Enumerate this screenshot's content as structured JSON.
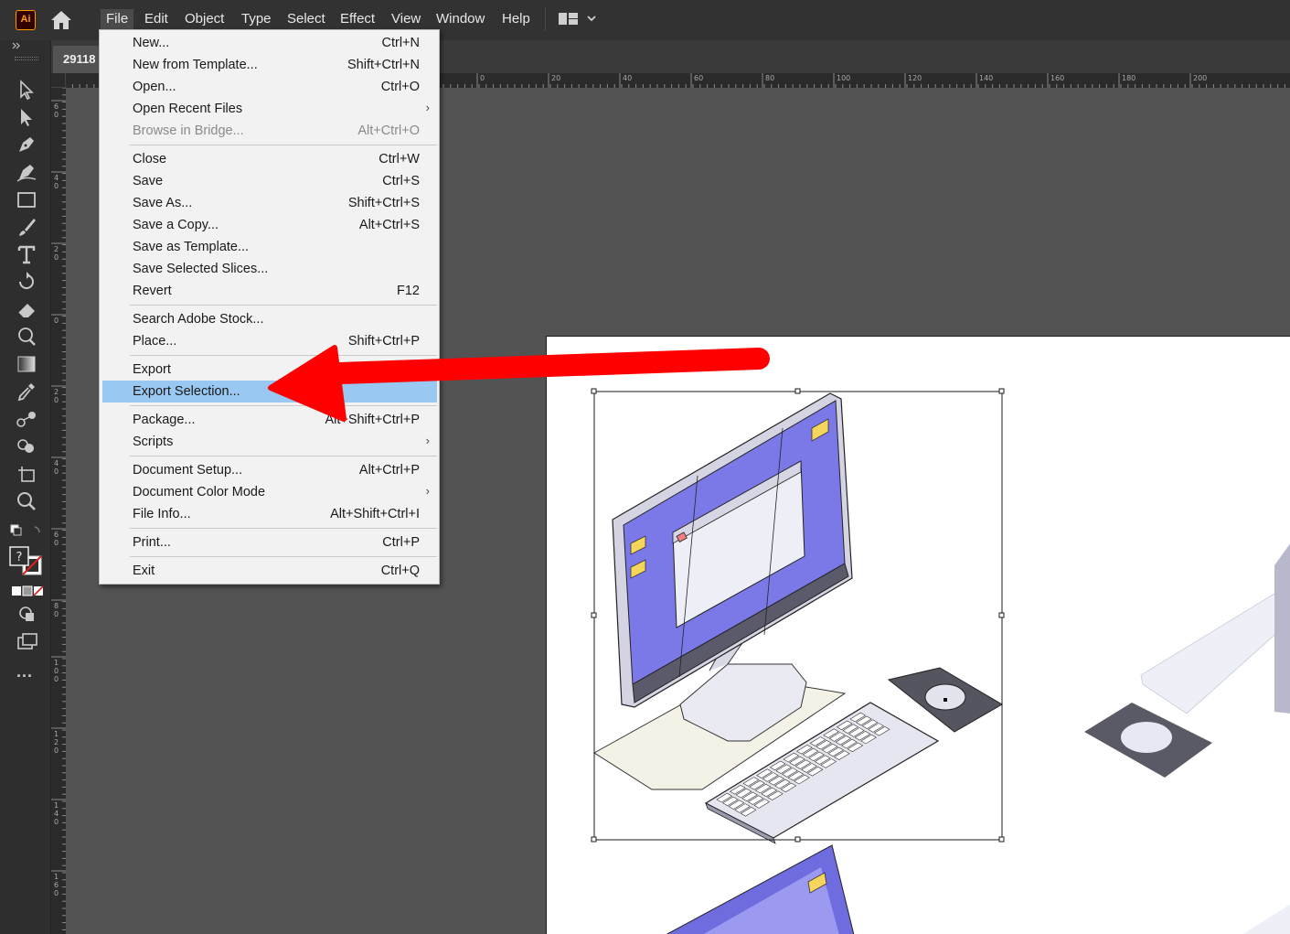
{
  "app": {
    "logo_text": "Ai"
  },
  "menubar": {
    "items": [
      "File",
      "Edit",
      "Object",
      "Type",
      "Select",
      "Effect",
      "View",
      "Window",
      "Help"
    ],
    "active": "File"
  },
  "document": {
    "tab_title": "29118"
  },
  "rulers": {
    "top_ticks": [
      "20",
      "0",
      "20",
      "40",
      "60",
      "80",
      "100",
      "120",
      "140",
      "160",
      "180",
      "200"
    ],
    "left_ticks": [
      "6\n0",
      "4\n0",
      "2\n0",
      "0",
      "2\n0",
      "4\n0",
      "6\n0",
      "8\n0",
      "1\n0\n0",
      "1\n2\n0",
      "1\n4\n0",
      "1\n6\n0"
    ]
  },
  "file_menu": {
    "groups": [
      [
        {
          "label": "New...",
          "shortcut": "Ctrl+N"
        },
        {
          "label": "New from Template...",
          "shortcut": "Shift+Ctrl+N"
        },
        {
          "label": "Open...",
          "shortcut": "Ctrl+O"
        },
        {
          "label": "Open Recent Files",
          "shortcut": "",
          "submenu": true
        },
        {
          "label": "Browse in Bridge...",
          "shortcut": "Alt+Ctrl+O",
          "disabled": true
        }
      ],
      [
        {
          "label": "Close",
          "shortcut": "Ctrl+W"
        },
        {
          "label": "Save",
          "shortcut": "Ctrl+S"
        },
        {
          "label": "Save As...",
          "shortcut": "Shift+Ctrl+S"
        },
        {
          "label": "Save a Copy...",
          "shortcut": "Alt+Ctrl+S"
        },
        {
          "label": "Save as Template...",
          "shortcut": ""
        },
        {
          "label": "Save Selected Slices...",
          "shortcut": ""
        },
        {
          "label": "Revert",
          "shortcut": "F12"
        }
      ],
      [
        {
          "label": "Search Adobe Stock...",
          "shortcut": ""
        },
        {
          "label": "Place...",
          "shortcut": "Shift+Ctrl+P"
        }
      ],
      [
        {
          "label": "Export",
          "shortcut": "",
          "submenu": true
        },
        {
          "label": "Export Selection...",
          "shortcut": "",
          "highlighted": true
        }
      ],
      [
        {
          "label": "Package...",
          "shortcut": "Alt+Shift+Ctrl+P"
        },
        {
          "label": "Scripts",
          "shortcut": "",
          "submenu": true
        }
      ],
      [
        {
          "label": "Document Setup...",
          "shortcut": "Alt+Ctrl+P"
        },
        {
          "label": "Document Color Mode",
          "shortcut": "",
          "submenu": true
        },
        {
          "label": "File Info...",
          "shortcut": "Alt+Shift+Ctrl+I"
        }
      ],
      [
        {
          "label": "Print...",
          "shortcut": "Ctrl+P"
        }
      ],
      [
        {
          "label": "Exit",
          "shortcut": "Ctrl+Q"
        }
      ]
    ]
  },
  "toolbar": {
    "tools": [
      "selection-tool",
      "direct-selection-tool",
      "pen-tool",
      "curvature-tool",
      "rectangle-tool",
      "paintbrush-tool",
      "type-tool",
      "rotate-tool",
      "eraser-tool",
      "warp-tool",
      "gradient-tool",
      "eyedropper-tool",
      "blend-tool",
      "shape-builder-tool",
      "artboard-tool",
      "zoom-tool"
    ],
    "more_label": "..."
  },
  "colors": {
    "highlight": "#99c8f2",
    "arrow": "#ff0000",
    "screen": "#7b79e8",
    "menubar": "#323232"
  }
}
